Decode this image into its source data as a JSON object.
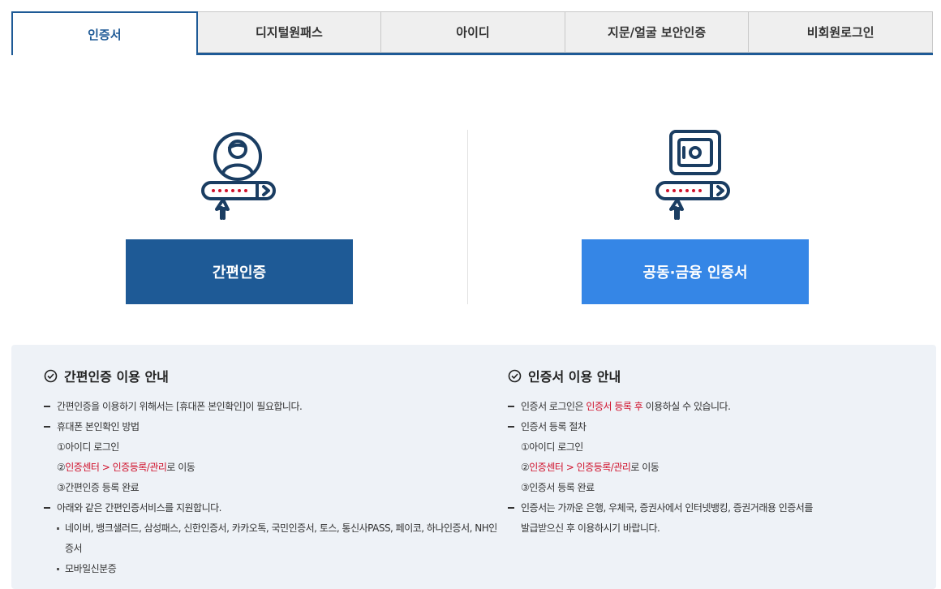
{
  "tabs": [
    {
      "label": "인증서",
      "active": true
    },
    {
      "label": "디지털원패스",
      "active": false
    },
    {
      "label": "아이디",
      "active": false
    },
    {
      "label": "지문/얼굴 보안인증",
      "active": false
    },
    {
      "label": "비회원로그인",
      "active": false
    }
  ],
  "options": {
    "simple": {
      "label": "간편인증",
      "icon": "user-password-icon",
      "color": "#1e5a96"
    },
    "cert": {
      "label": "공동·금융 인증서",
      "icon": "safe-password-icon",
      "color": "#3586e6"
    }
  },
  "colors": {
    "accent": "#1e5a96",
    "highlight": "#d0112b",
    "panel": "#eef2f7"
  },
  "guide_left": {
    "title": "간편인증 이용 안내",
    "l1": "간편인증을 이용하기 위해서는 [휴대폰 본인확인]이 필요합니다.",
    "l2": "휴대폰 본인확인 방법",
    "s1": "①아이디 로그인",
    "s2_prefix": "②",
    "s2_red": "인증센터 > 인증등록/관리",
    "s2_suffix": "로 이동",
    "s3": "③간편인증 등록 완료",
    "l3": "아래와 같은 간편인증서비스를 지원합니다.",
    "b1_line1": "네이버, 뱅크샐러드, 삼성패스, 신한인증서, 카카오톡, 국민인증서, 토스, 통신사PASS, 페이코, 하나인증서, NH인",
    "b1_line2": "증서",
    "b2": "모바일신분증"
  },
  "guide_right": {
    "title": "인증서 이용 안내",
    "l1_prefix": "인증서 로그인은 ",
    "l1_red": "인증서 등록 후",
    "l1_suffix": " 이용하실 수 있습니다.",
    "l2": "인증서 등록 절차",
    "s1": "①아이디 로그인",
    "s2_prefix": "②",
    "s2_red": "인증센터 > 인증등록/관리",
    "s2_suffix": "로 이동",
    "s3": "③인증서 등록 완료",
    "l3_line1": "인증서는 가까운 은행, 우체국, 증권사에서 인터넷뱅킹, 증권거래용 인증서를",
    "l3_line2": "발급받으신 후 이용하시기 바랍니다."
  }
}
